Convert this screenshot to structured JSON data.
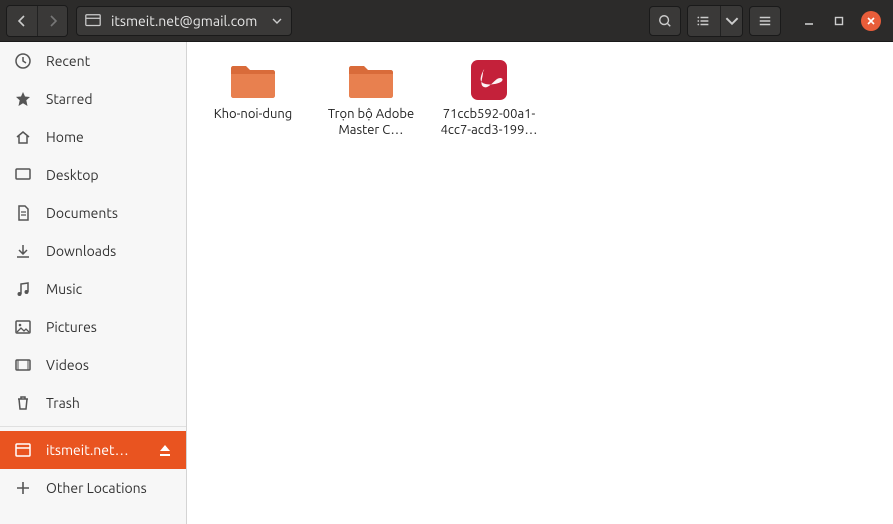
{
  "header": {
    "path_label": "itsmeit.net@gmail.com"
  },
  "sidebar": {
    "items": [
      {
        "id": "recent",
        "label": "Recent"
      },
      {
        "id": "starred",
        "label": "Starred"
      },
      {
        "id": "home",
        "label": "Home"
      },
      {
        "id": "desktop",
        "label": "Desktop"
      },
      {
        "id": "documents",
        "label": "Documents"
      },
      {
        "id": "downloads",
        "label": "Downloads"
      },
      {
        "id": "music",
        "label": "Music"
      },
      {
        "id": "pictures",
        "label": "Pictures"
      },
      {
        "id": "videos",
        "label": "Videos"
      },
      {
        "id": "trash",
        "label": "Trash"
      }
    ],
    "mount": {
      "label": "itsmeit.net…"
    },
    "other": {
      "label": "Other Locations"
    }
  },
  "files": [
    {
      "type": "folder",
      "name": "Kho-noi-dung"
    },
    {
      "type": "folder",
      "name": "Trọn bộ Adobe Master C…"
    },
    {
      "type": "pdf",
      "name": "71ccb592-00a1-4cc7-acd3-199…"
    }
  ]
}
